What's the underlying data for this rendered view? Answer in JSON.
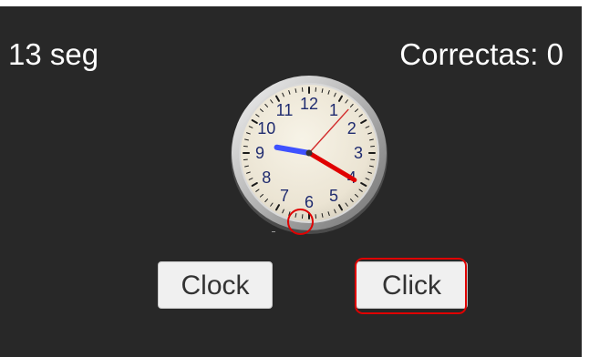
{
  "timer": {
    "text": "13 seg"
  },
  "score": {
    "text": "Correctas: 0"
  },
  "clock": {
    "numbers": [
      "12",
      "1",
      "2",
      "3",
      "4",
      "5",
      "6",
      "7",
      "8",
      "9",
      "10",
      "11"
    ],
    "time": {
      "hour": 9,
      "minute": 20,
      "second": 7
    }
  },
  "buttons": {
    "clock_label": "Clock",
    "click_label": "Click"
  },
  "colors": {
    "background": "#282828",
    "accent": "#e00000",
    "hour_hand": "#3f52ff",
    "minute_hand": "#e00000",
    "second_hand": "#e00000"
  }
}
